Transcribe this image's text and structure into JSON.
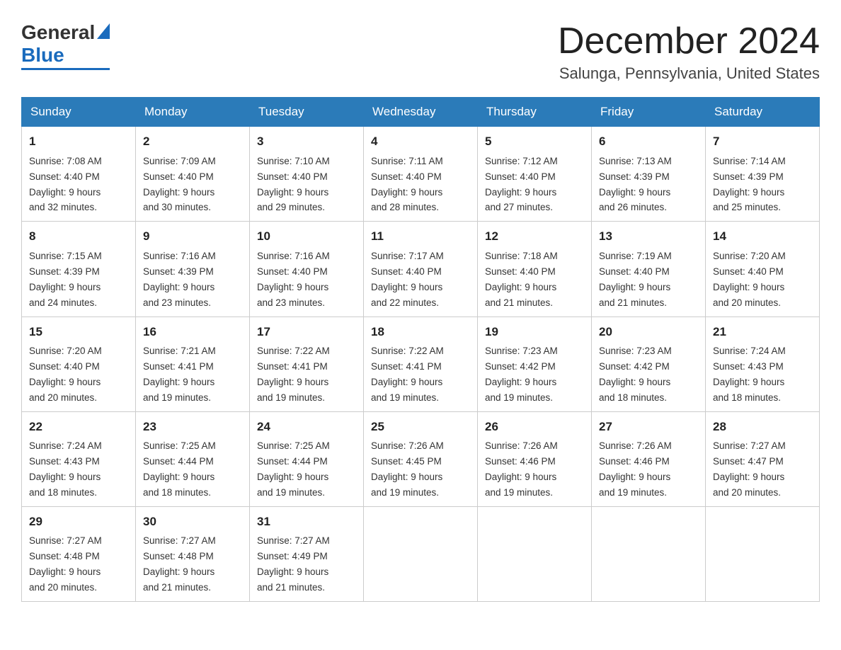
{
  "logo": {
    "general": "General",
    "blue": "Blue",
    "aria": "GeneralBlue logo"
  },
  "title": {
    "month_year": "December 2024",
    "location": "Salunga, Pennsylvania, United States"
  },
  "days_of_week": [
    "Sunday",
    "Monday",
    "Tuesday",
    "Wednesday",
    "Thursday",
    "Friday",
    "Saturday"
  ],
  "weeks": [
    [
      {
        "day": "1",
        "sunrise": "7:08 AM",
        "sunset": "4:40 PM",
        "daylight": "9 hours and 32 minutes."
      },
      {
        "day": "2",
        "sunrise": "7:09 AM",
        "sunset": "4:40 PM",
        "daylight": "9 hours and 30 minutes."
      },
      {
        "day": "3",
        "sunrise": "7:10 AM",
        "sunset": "4:40 PM",
        "daylight": "9 hours and 29 minutes."
      },
      {
        "day": "4",
        "sunrise": "7:11 AM",
        "sunset": "4:40 PM",
        "daylight": "9 hours and 28 minutes."
      },
      {
        "day": "5",
        "sunrise": "7:12 AM",
        "sunset": "4:40 PM",
        "daylight": "9 hours and 27 minutes."
      },
      {
        "day": "6",
        "sunrise": "7:13 AM",
        "sunset": "4:39 PM",
        "daylight": "9 hours and 26 minutes."
      },
      {
        "day": "7",
        "sunrise": "7:14 AM",
        "sunset": "4:39 PM",
        "daylight": "9 hours and 25 minutes."
      }
    ],
    [
      {
        "day": "8",
        "sunrise": "7:15 AM",
        "sunset": "4:39 PM",
        "daylight": "9 hours and 24 minutes."
      },
      {
        "day": "9",
        "sunrise": "7:16 AM",
        "sunset": "4:39 PM",
        "daylight": "9 hours and 23 minutes."
      },
      {
        "day": "10",
        "sunrise": "7:16 AM",
        "sunset": "4:40 PM",
        "daylight": "9 hours and 23 minutes."
      },
      {
        "day": "11",
        "sunrise": "7:17 AM",
        "sunset": "4:40 PM",
        "daylight": "9 hours and 22 minutes."
      },
      {
        "day": "12",
        "sunrise": "7:18 AM",
        "sunset": "4:40 PM",
        "daylight": "9 hours and 21 minutes."
      },
      {
        "day": "13",
        "sunrise": "7:19 AM",
        "sunset": "4:40 PM",
        "daylight": "9 hours and 21 minutes."
      },
      {
        "day": "14",
        "sunrise": "7:20 AM",
        "sunset": "4:40 PM",
        "daylight": "9 hours and 20 minutes."
      }
    ],
    [
      {
        "day": "15",
        "sunrise": "7:20 AM",
        "sunset": "4:40 PM",
        "daylight": "9 hours and 20 minutes."
      },
      {
        "day": "16",
        "sunrise": "7:21 AM",
        "sunset": "4:41 PM",
        "daylight": "9 hours and 19 minutes."
      },
      {
        "day": "17",
        "sunrise": "7:22 AM",
        "sunset": "4:41 PM",
        "daylight": "9 hours and 19 minutes."
      },
      {
        "day": "18",
        "sunrise": "7:22 AM",
        "sunset": "4:41 PM",
        "daylight": "9 hours and 19 minutes."
      },
      {
        "day": "19",
        "sunrise": "7:23 AM",
        "sunset": "4:42 PM",
        "daylight": "9 hours and 19 minutes."
      },
      {
        "day": "20",
        "sunrise": "7:23 AM",
        "sunset": "4:42 PM",
        "daylight": "9 hours and 18 minutes."
      },
      {
        "day": "21",
        "sunrise": "7:24 AM",
        "sunset": "4:43 PM",
        "daylight": "9 hours and 18 minutes."
      }
    ],
    [
      {
        "day": "22",
        "sunrise": "7:24 AM",
        "sunset": "4:43 PM",
        "daylight": "9 hours and 18 minutes."
      },
      {
        "day": "23",
        "sunrise": "7:25 AM",
        "sunset": "4:44 PM",
        "daylight": "9 hours and 18 minutes."
      },
      {
        "day": "24",
        "sunrise": "7:25 AM",
        "sunset": "4:44 PM",
        "daylight": "9 hours and 19 minutes."
      },
      {
        "day": "25",
        "sunrise": "7:26 AM",
        "sunset": "4:45 PM",
        "daylight": "9 hours and 19 minutes."
      },
      {
        "day": "26",
        "sunrise": "7:26 AM",
        "sunset": "4:46 PM",
        "daylight": "9 hours and 19 minutes."
      },
      {
        "day": "27",
        "sunrise": "7:26 AM",
        "sunset": "4:46 PM",
        "daylight": "9 hours and 19 minutes."
      },
      {
        "day": "28",
        "sunrise": "7:27 AM",
        "sunset": "4:47 PM",
        "daylight": "9 hours and 20 minutes."
      }
    ],
    [
      {
        "day": "29",
        "sunrise": "7:27 AM",
        "sunset": "4:48 PM",
        "daylight": "9 hours and 20 minutes."
      },
      {
        "day": "30",
        "sunrise": "7:27 AM",
        "sunset": "4:48 PM",
        "daylight": "9 hours and 21 minutes."
      },
      {
        "day": "31",
        "sunrise": "7:27 AM",
        "sunset": "4:49 PM",
        "daylight": "9 hours and 21 minutes."
      },
      null,
      null,
      null,
      null
    ]
  ],
  "labels": {
    "sunrise": "Sunrise:",
    "sunset": "Sunset:",
    "daylight": "Daylight:"
  }
}
